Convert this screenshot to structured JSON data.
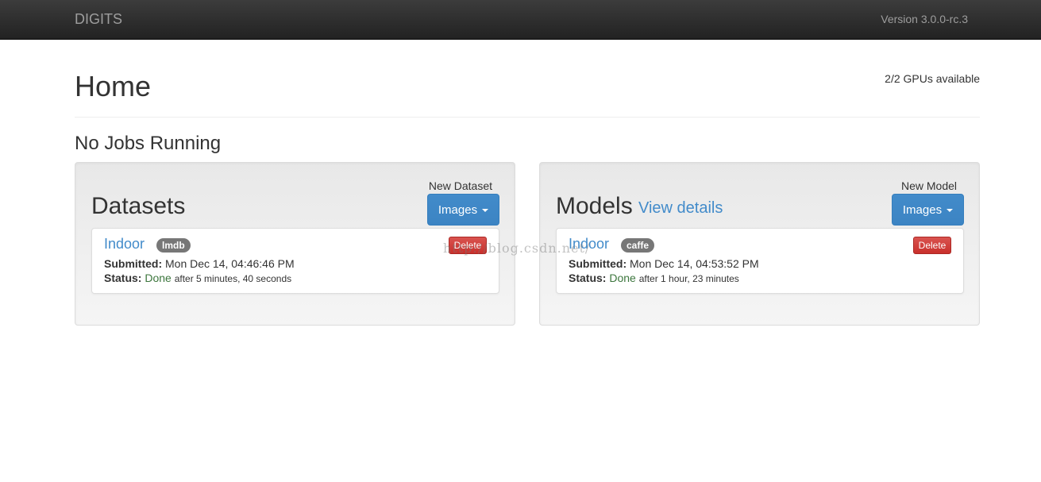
{
  "navbar": {
    "brand": "DIGITS",
    "version": "Version 3.0.0-rc.3"
  },
  "page": {
    "title": "Home",
    "gpus": "2/2 GPUs available",
    "jobs_heading": "No Jobs Running"
  },
  "datasets": {
    "title": "Datasets",
    "new_label": "New Dataset",
    "button_label": "Images",
    "job": {
      "name": "Indoor",
      "badge": "lmdb",
      "delete_label": "Delete",
      "submitted_label": "Submitted:",
      "submitted_value": "Mon Dec 14, 04:46:46 PM",
      "status_label": "Status:",
      "status_value": "Done",
      "duration": "after 5 minutes, 40 seconds"
    }
  },
  "models": {
    "title": "Models",
    "view_details": "View details",
    "new_label": "New Model",
    "button_label": "Images",
    "job": {
      "name": "Indoor",
      "badge": "caffe",
      "delete_label": "Delete",
      "submitted_label": "Submitted:",
      "submitted_value": "Mon Dec 14, 04:53:52 PM",
      "status_label": "Status:",
      "status_value": "Done",
      "duration": "after 1 hour, 23 minutes"
    }
  },
  "watermark": "http://blog.csdn.net/",
  "colors": {
    "primary": "#428bca",
    "danger": "#d9534f",
    "success_text": "#3c763d",
    "badge": "#777777",
    "navbar": "#222222"
  }
}
